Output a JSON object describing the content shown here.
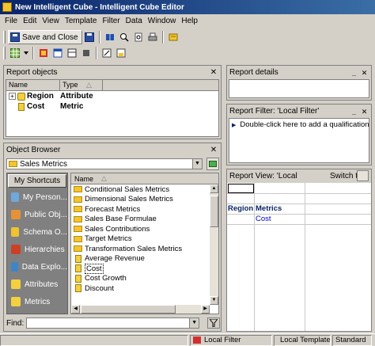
{
  "window": {
    "title": "New Intelligent Cube - Intelligent Cube Editor"
  },
  "menu": [
    "File",
    "Edit",
    "View",
    "Template",
    "Filter",
    "Data",
    "Window",
    "Help"
  ],
  "toolbar": {
    "save_close_label": "Save and Close"
  },
  "report_objects": {
    "title": "Report objects",
    "columns": [
      "Name",
      "Type"
    ],
    "rows": [
      {
        "name": "Region",
        "type": "Attribute",
        "expander": "+"
      },
      {
        "name": "Cost",
        "type": "Metric"
      }
    ]
  },
  "report_details": {
    "title": "Report details"
  },
  "report_filter": {
    "title": "Report Filter: 'Local Filter'",
    "hint": "Double-click here to add a qualification, or dr"
  },
  "report_view": {
    "title": "Report View: 'Local",
    "switch_label": "Switch to:",
    "grid": {
      "row_header": "Region",
      "col_header": "Metrics",
      "metric": "Cost"
    }
  },
  "object_browser": {
    "title": "Object Browser",
    "folder": "Sales Metrics",
    "shortcuts_title": "My Shortcuts",
    "shortcuts": [
      "My Person...",
      "Public Obj...",
      "Schema O...",
      "Hierarchies",
      "Data Explo...",
      "Attributes",
      "Metrics"
    ],
    "list_header": "Name",
    "items": [
      {
        "label": "Conditional Sales Metrics",
        "kind": "folder"
      },
      {
        "label": "Dimensional Sales Metrics",
        "kind": "folder"
      },
      {
        "label": "Forecast Metrics",
        "kind": "folder"
      },
      {
        "label": "Sales Base Formulae",
        "kind": "folder"
      },
      {
        "label": "Sales Contributions",
        "kind": "folder"
      },
      {
        "label": "Target Metrics",
        "kind": "folder"
      },
      {
        "label": "Transformation Sales Metrics",
        "kind": "folder"
      },
      {
        "label": "Average Revenue",
        "kind": "metric"
      },
      {
        "label": "Cost",
        "kind": "metric",
        "selected": true
      },
      {
        "label": "Cost Growth",
        "kind": "metric"
      },
      {
        "label": "Discount",
        "kind": "metric"
      }
    ],
    "find_label": "Find:"
  },
  "statusbar": {
    "filter": "Local Filter",
    "template": "Local Template",
    "mode": "Standard"
  },
  "colors": {
    "title_start": "#0a246a",
    "title_end": "#3a6ea5",
    "chrome": "#d4d0c8",
    "shortcut_bg": "#808080",
    "metric_blue": "#0000cc"
  }
}
